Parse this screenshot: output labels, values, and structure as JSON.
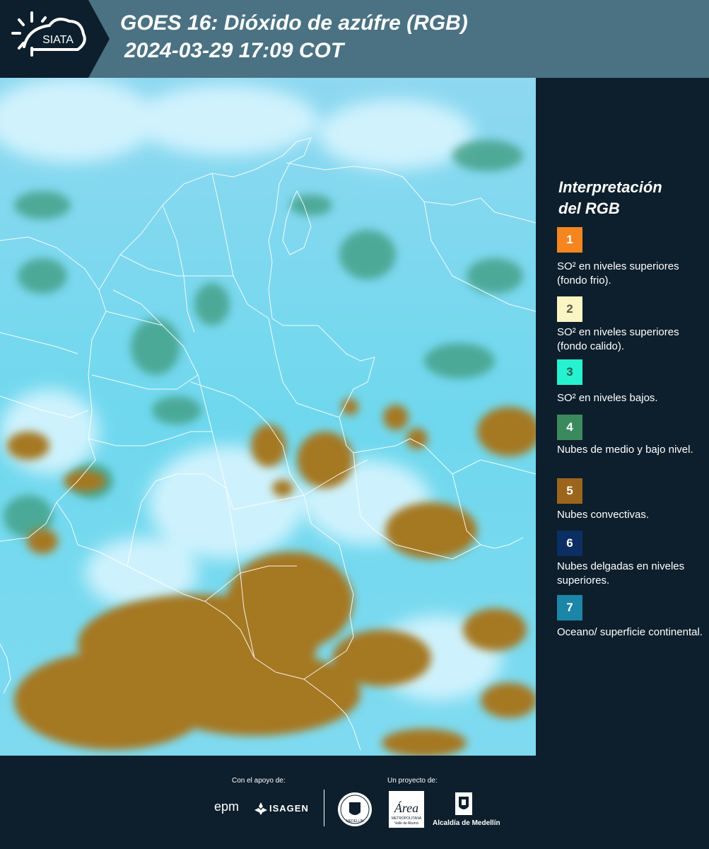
{
  "header": {
    "logo_text": "SIATA",
    "title_line1": "GOES 16: Dióxido de azúfre (RGB)",
    "title_line2": "2024-03-29 17:09 COT"
  },
  "legend": {
    "title_line1": "Interpretación",
    "title_line2": "del RGB",
    "items": [
      {
        "number": "1",
        "color": "#f5861f",
        "text_color": "#ffffff",
        "label": "SO² en niveles superiores (fondo frio)."
      },
      {
        "number": "2",
        "color": "#fbf5c3",
        "text_color": "#5a5a4a",
        "label": "SO² en niveles superiores (fondo calido)."
      },
      {
        "number": "3",
        "color": "#26f2cf",
        "text_color": "#1c5a50",
        "label": "SO² en niveles bajos."
      },
      {
        "number": "4",
        "color": "#3b8a5e",
        "text_color": "#ffffff",
        "label": "Nubes de medio y bajo nivel."
      },
      {
        "number": "5",
        "color": "#9c651c",
        "text_color": "#ffffff",
        "label": "Nubes convectivas."
      },
      {
        "number": "6",
        "color": "#0b2e63",
        "text_color": "#ffffff",
        "label": "Nubes delgadas en niveles superiores."
      },
      {
        "number": "7",
        "color": "#1b86a8",
        "text_color": "#ffffff",
        "label": "Oceano/ superficie continental."
      }
    ]
  },
  "footer": {
    "support_label": "Con el apoyo de:",
    "project_label": "Un proyecto de:",
    "epm": "epm",
    "isagen": "ISAGEN",
    "area_script": "Área",
    "area_sub1": "METROPOLITANA",
    "area_sub2": "Valle de Aburrá",
    "alcaldia": "Alcaldía de Medellín",
    "seal_text": "MEDELLÍN"
  }
}
